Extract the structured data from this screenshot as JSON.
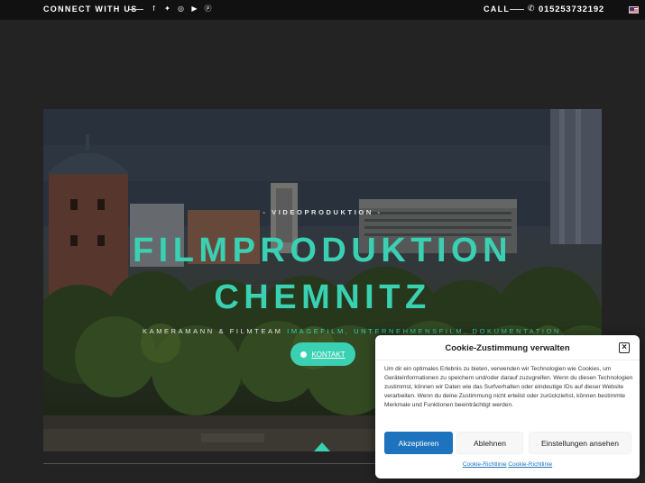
{
  "topbar": {
    "connect_label": "CONNECT WITH US",
    "social_icons": [
      "facebook-icon",
      "twitter-icon",
      "instagram-icon",
      "youtube-icon",
      "pinterest-icon"
    ],
    "call_label": "CALL",
    "phone": "015253732192",
    "language_flag": "us-flag"
  },
  "hero": {
    "eyebrow": "- VIDEOPRODUKTION -",
    "title_line1": "FILMPRODUKTION",
    "title_line2": "CHEMNITZ",
    "subtitle_plain": "KAMERAMANN & FILMTEAM",
    "subtitle_accent": "IMAGEFILM, UNTERNEHMENSFILM, DOKUMENTATION",
    "cta_label": "KONTAKT",
    "accent_color": "#3ad1b3"
  },
  "cookie": {
    "title": "Cookie-Zustimmung verwalten",
    "body": "Um dir ein optimales Erlebnis zu bieten, verwenden wir Technologien wie Cookies, um Geräteinformationen zu speichern und/oder darauf zuzugreifen. Wenn du diesen Technologien zustimmst, können wir Daten wie das Surfverhalten oder eindeutige IDs auf dieser Website verarbeiten. Wenn du deine Zustimmung nicht erteilst oder zurückziehst, können bestimmte Merkmale und Funktionen beeinträchtigt werden.",
    "accept_label": "Akzeptieren",
    "deny_label": "Ablehnen",
    "settings_label": "Einstellungen ansehen",
    "link1": "Cookie-Richtlinie",
    "link2": "Cookie-Richtlinie",
    "accept_color": "#1e73be"
  }
}
